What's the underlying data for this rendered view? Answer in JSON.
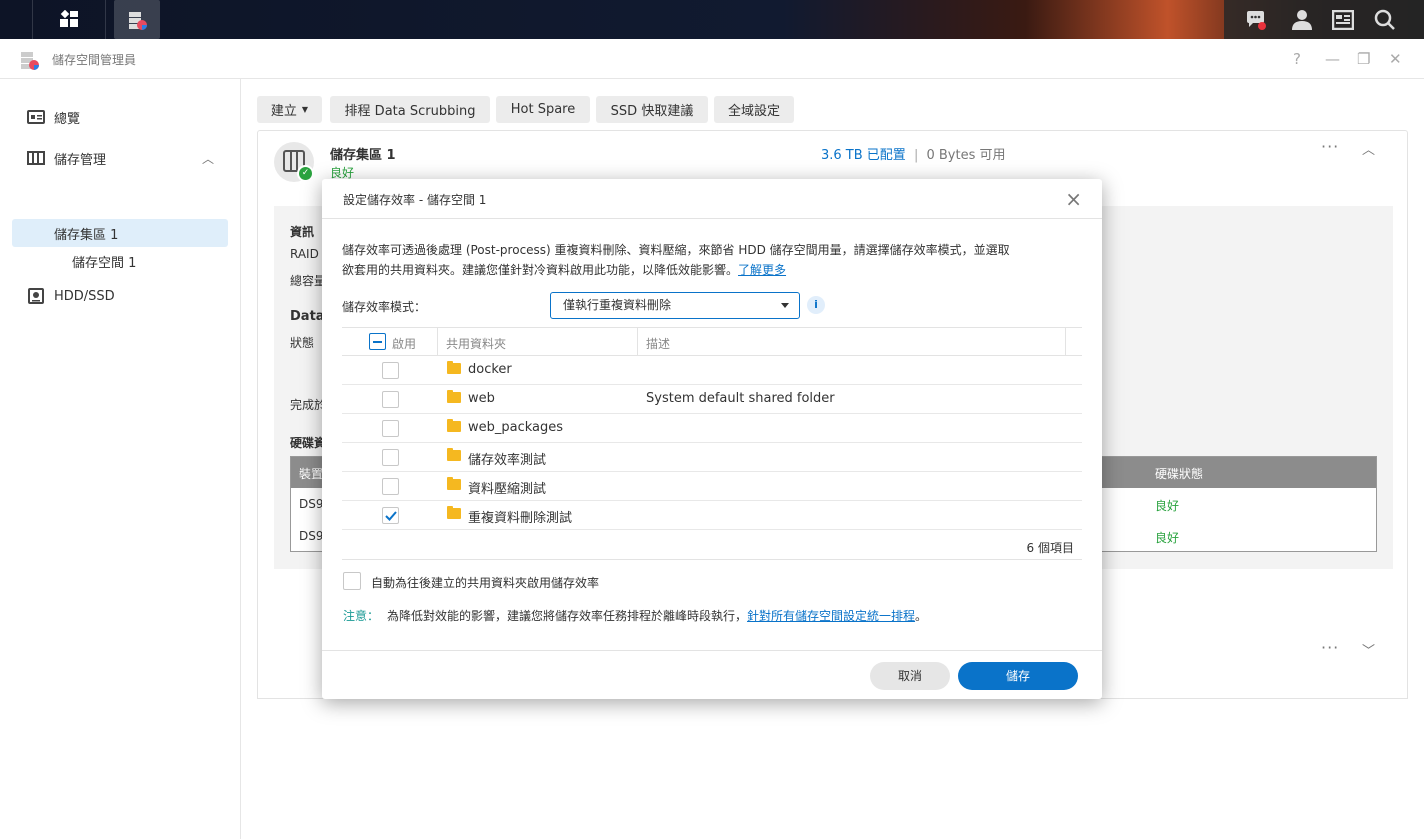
{
  "app": {
    "title": "儲存空間管理員",
    "window_controls": [
      "?",
      "—",
      "❐",
      "✕"
    ]
  },
  "sidebar": {
    "items": [
      {
        "label": "總覽",
        "icon": "overview-icon"
      },
      {
        "label": "儲存管理",
        "icon": "storage-icon"
      },
      {
        "label": "儲存集區 1"
      },
      {
        "label": "儲存空間 1"
      },
      {
        "label": "HDD/SSD",
        "icon": "hdd-icon"
      }
    ]
  },
  "toolbar": {
    "create": "建立",
    "scrubbing": "排程 Data Scrubbing",
    "hotspare": "Hot Spare",
    "ssd": "SSD 快取建議",
    "global": "全域設定"
  },
  "pool": {
    "name": "儲存集區 1",
    "status": "良好",
    "allocated": "3.6 TB 已配置",
    "separator": "|",
    "available": "0 Bytes 可用",
    "info_label": "資訊",
    "raid_label": "RAID",
    "capacity_label": "總容量",
    "data_label": "Data",
    "status_label": "狀態",
    "finish_label": "完成於",
    "disk_label": "硬碟資",
    "table_head_device": "裝置",
    "table_head_status": "硬碟狀態",
    "rows": [
      {
        "device": "DS9",
        "status": "良好"
      },
      {
        "device": "DS9",
        "status": "良好"
      }
    ]
  },
  "dialog": {
    "title": "設定儲存效率 - 儲存空間 1",
    "desc_line1": "儲存效率可透過後處理 (Post-process) 重複資料刪除、資料壓縮，來節省 HDD 儲存空間用量，請選擇儲存效率模式，並選取",
    "desc_line2": "欲套用的共用資料夾。建議您僅針對冷資料啟用此功能，以降低效能影響。",
    "learn_more": "了解更多",
    "mode_label": "儲存效率模式：",
    "mode_value": "僅執行重複資料刪除",
    "columns": {
      "enable": "啟用",
      "folder": "共用資料夾",
      "desc": "描述"
    },
    "folders": [
      {
        "name": "docker",
        "desc": "",
        "checked": false
      },
      {
        "name": "web",
        "desc": "System default shared folder",
        "checked": false
      },
      {
        "name": "web_packages",
        "desc": "",
        "checked": false
      },
      {
        "name": "儲存效率測試",
        "desc": "",
        "checked": false
      },
      {
        "name": "資料壓縮測試",
        "desc": "",
        "checked": false
      },
      {
        "name": "重複資料刪除測試",
        "desc": "",
        "checked": true
      }
    ],
    "count": "6 個項目",
    "auto_label": "自動為往後建立的共用資料夾啟用儲存效率",
    "note_label": "注意：",
    "note_text": "為降低對效能的影響，建議您將儲存效率任務排程於離峰時段執行，",
    "note_link": "針對所有儲存空間設定統一排程",
    "note_end": "。",
    "cancel": "取消",
    "save": "儲存"
  },
  "colors": {
    "accent": "#0a73c9",
    "success": "#2aa33f",
    "teal": "#1a9a95",
    "folder": "#f5b820"
  }
}
